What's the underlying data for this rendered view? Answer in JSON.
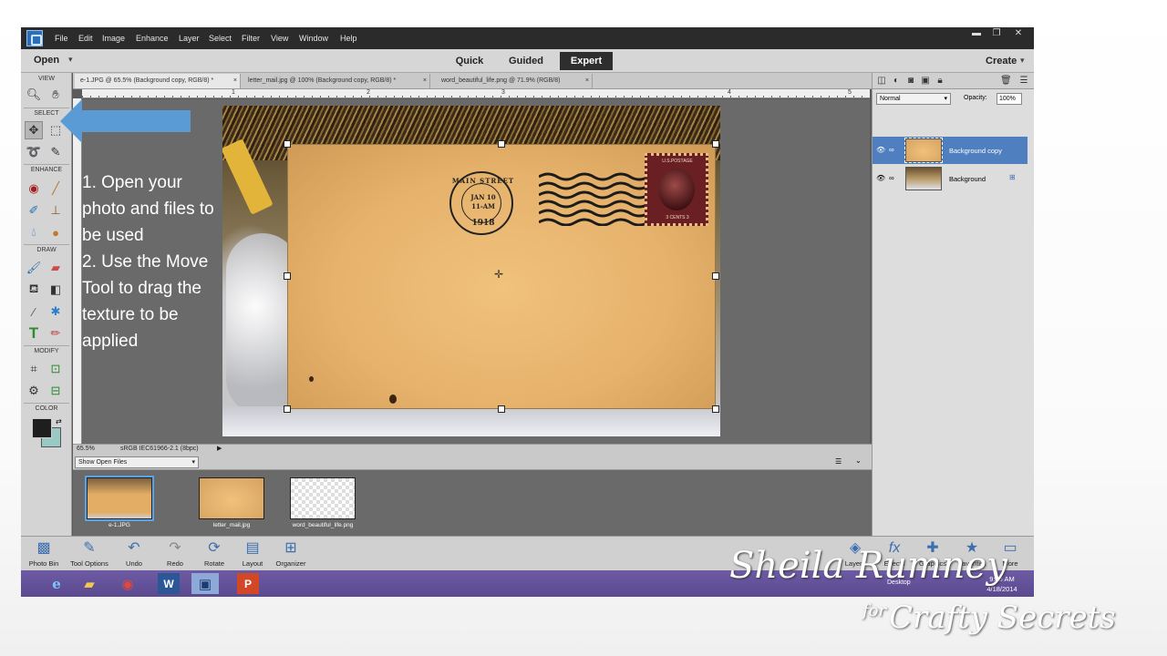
{
  "menubar": {
    "items": [
      "File",
      "Edit",
      "Image",
      "Enhance",
      "Layer",
      "Select",
      "Filter",
      "View",
      "Window",
      "Help"
    ]
  },
  "modebar": {
    "open": "Open",
    "tabs": [
      "Quick",
      "Guided",
      "Expert"
    ],
    "active_tab": "Expert",
    "create": "Create"
  },
  "toolbox": {
    "sections": [
      "VIEW",
      "SELECT",
      "ENHANCE",
      "DRAW",
      "MODIFY",
      "COLOR"
    ],
    "foreground_color": "#1e1e1e",
    "background_color": "#9ac8c4"
  },
  "doc_tabs": [
    "e-1.JPG @ 65.5% (Background copy, RGB/8) *",
    "letter_mail.jpg @ 100% (Background copy, RGB/8) *",
    "word_beautiful_life.png @ 71.9% (RGB/8)"
  ],
  "ruler_marks": [
    "1",
    "2",
    "3",
    "4",
    "5"
  ],
  "envelope": {
    "postmark_line1": "MAIN STREET",
    "postmark_date": "JAN 10",
    "postmark_time": "11-AM",
    "postmark_year": "1918",
    "stamp_top": "U.S.POSTAGE",
    "stamp_bottom": "3 CENTS 3"
  },
  "instructions": {
    "line1": "1. Open your photo and files to be used",
    "line2": "2. Use the Move Tool to drag the texture to be applied"
  },
  "statusbar": {
    "zoom": "65.5%",
    "profile": "sRGB IEC61966-2.1 (8bpc)"
  },
  "photobin": {
    "filter": "Show Open Files",
    "thumbs": [
      "e-1.JPG",
      "letter_mail.jpg",
      "word_beautiful_life.png"
    ],
    "selected": "e-1.JPG"
  },
  "layers_panel": {
    "blend_mode": "Normal",
    "opacity_label": "Opacity:",
    "opacity_value": "100%",
    "layers": [
      "Background copy",
      "Background"
    ],
    "selected_layer": "Background copy"
  },
  "taskbar_left": [
    "Photo Bin",
    "Tool Options",
    "Undo",
    "Redo",
    "Rotate",
    "Layout",
    "Organizer"
  ],
  "taskbar_right": [
    "Layers",
    "Effects",
    "Graphics",
    "Favorites",
    "More"
  ],
  "windows": {
    "desktop": "Desktop",
    "time": "9:55 AM",
    "date": "4/18/2014"
  },
  "watermark": {
    "name": "Sheila Rumney",
    "for": "for",
    "brand": "Crafty Secrets"
  },
  "colors": {
    "accent_arrow": "#5b9bd5",
    "selected_layer": "#4f7fbf",
    "win_taskbar": "#5b4a90"
  }
}
